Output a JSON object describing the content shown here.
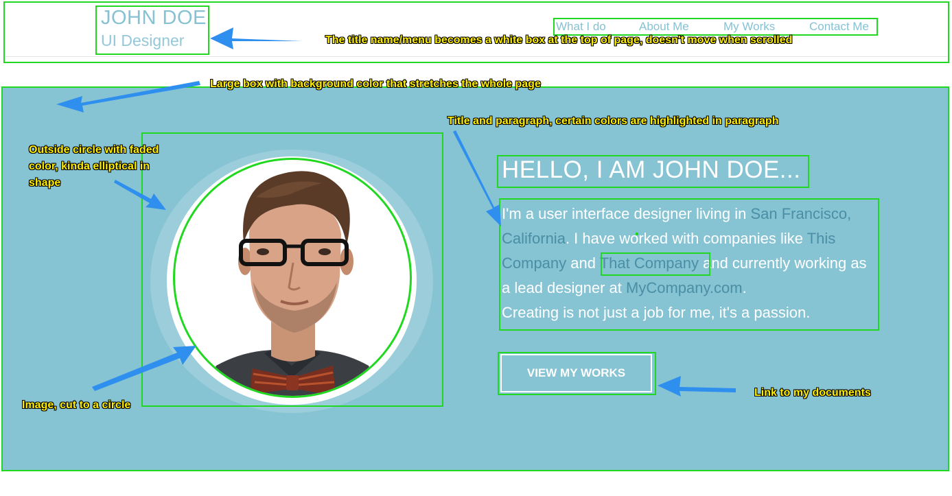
{
  "header": {
    "name": "JOHN DOE",
    "role": "UI Designer",
    "nav": [
      "What I do",
      "About Me",
      "My Works",
      "Contact Me"
    ]
  },
  "hero": {
    "title": "HELLO, I AM JOHN DOE...",
    "paragraph": {
      "p1": "I'm a user interface designer living in ",
      "h1": "San Francisco, California",
      "p2": ". I have worked with companies like ",
      "h2": "This Company",
      "p3": " and ",
      "h3": "That Company",
      "p4": " and currently working as a lead designer at ",
      "h4": "MyCompany.com",
      "p5": ".",
      "line2": "Creating is not just a job for me, it's a passion."
    },
    "button_label": "VIEW MY WORKS"
  },
  "annotations": {
    "header_note": "The title name/menu becomes a white box at the top of page, doesn't move when scrolled",
    "bg_note": "Large box with background color that stretches the whole page",
    "text_note": "Title and paragraph, certain colors are highlighted in paragraph",
    "ring_note": [
      "Outside circle with faded",
      "color, kinda elliptical in",
      "shape"
    ],
    "image_note": "Image, cut to a circle",
    "link_note": "Link to my documents"
  },
  "colors": {
    "hero_bg": "#86c3d3",
    "accent": "#86c2d3",
    "highlight": "#4a8fa6",
    "annotation_box": "#20d820",
    "annotation_arrow": "#2e8fee",
    "annotation_text": "#ffee00"
  },
  "icons": {
    "portrait": "portrait-photo"
  }
}
